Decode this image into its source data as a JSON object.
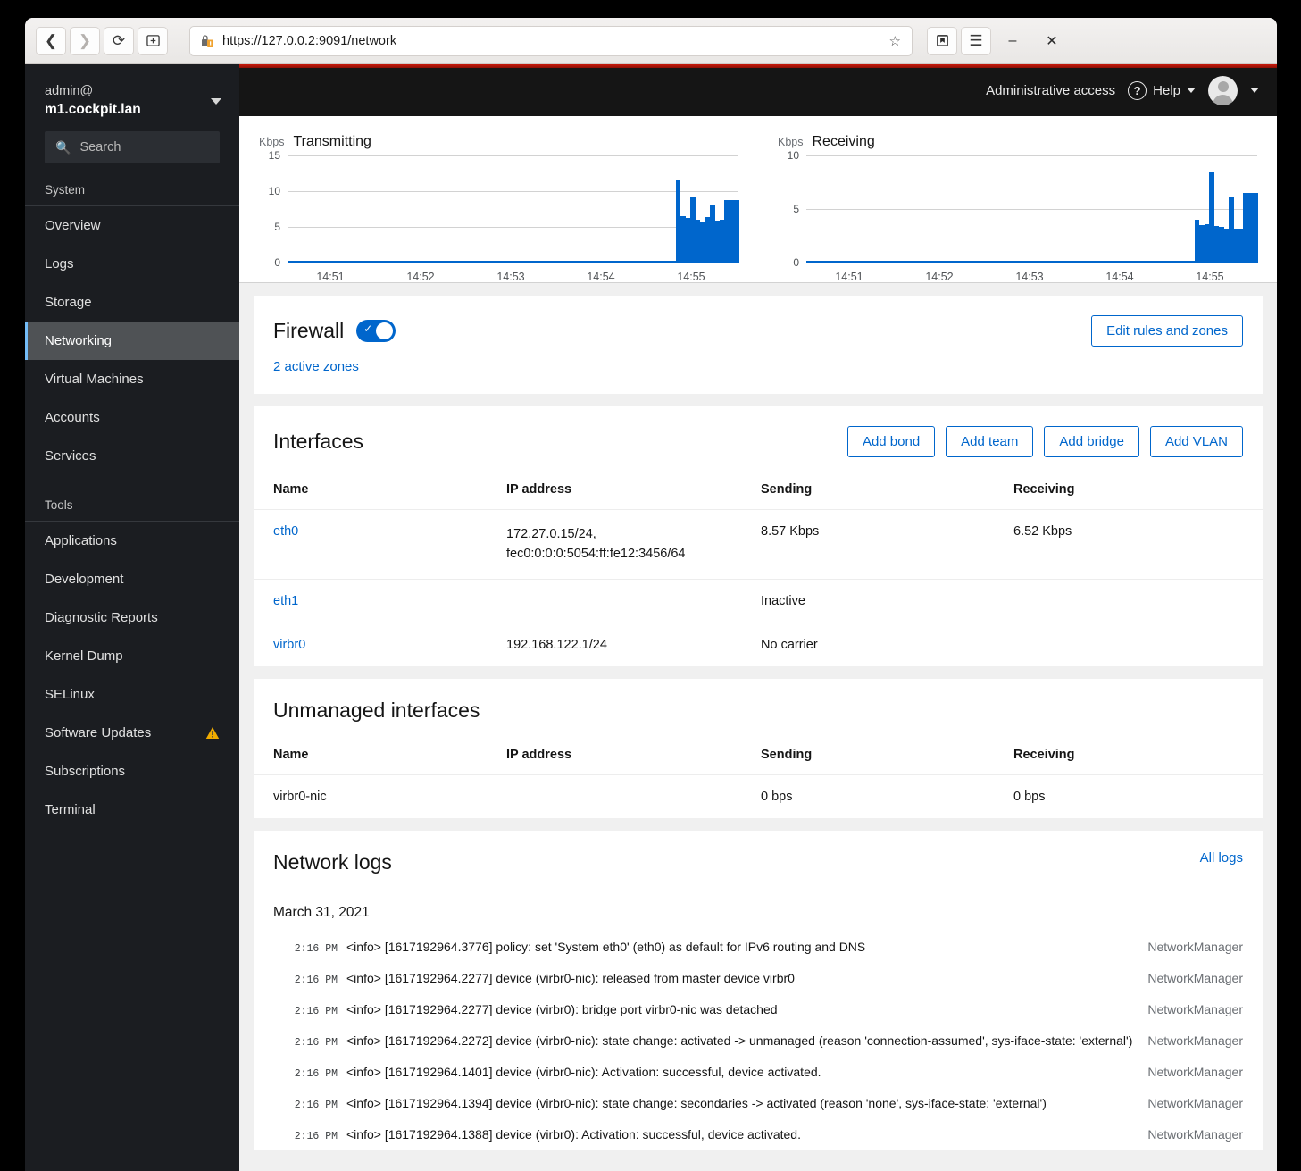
{
  "browser": {
    "back_icon": "back-arrow-icon",
    "forward_icon": "forward-arrow-icon",
    "reload_icon": "reload-icon",
    "newtab_icon": "new-tab-icon",
    "url": "https://127.0.0.2:9091/network",
    "bookmark_icon": "star-icon",
    "library_icon": "library-icon",
    "menu_icon": "hamburger-menu-icon",
    "minimize_label": "–",
    "close_label": "✕"
  },
  "sidebar": {
    "host_user": "admin@",
    "host_name": "m1.cockpit.lan",
    "search_placeholder": "Search",
    "groups": [
      {
        "title": "System",
        "items": [
          {
            "label": "Overview",
            "active": false
          },
          {
            "label": "Logs",
            "active": false
          },
          {
            "label": "Storage",
            "active": false
          },
          {
            "label": "Networking",
            "active": true
          },
          {
            "label": "Virtual Machines",
            "active": false
          },
          {
            "label": "Accounts",
            "active": false
          },
          {
            "label": "Services",
            "active": false
          }
        ]
      },
      {
        "title": "Tools",
        "items": [
          {
            "label": "Applications",
            "active": false
          },
          {
            "label": "Development",
            "active": false
          },
          {
            "label": "Diagnostic Reports",
            "active": false
          },
          {
            "label": "Kernel Dump",
            "active": false
          },
          {
            "label": "SELinux",
            "active": false
          },
          {
            "label": "Software Updates",
            "active": false,
            "badge": "warning-triangle-icon"
          },
          {
            "label": "Subscriptions",
            "active": false
          },
          {
            "label": "Terminal",
            "active": false
          }
        ]
      }
    ]
  },
  "header": {
    "admin_access": "Administrative access",
    "help_label": "Help",
    "help_icon": "question-circle-icon",
    "avatar_icon": "user-avatar-icon",
    "accent_color": "#c9190b"
  },
  "chart_data": [
    {
      "type": "area",
      "title": "Transmitting",
      "unit": "Kbps",
      "ylabel": "Kbps",
      "xlabel": "",
      "ylim": [
        0,
        15
      ],
      "yticks": [
        0,
        5,
        10,
        15
      ],
      "xticks": [
        "14:51",
        "14:52",
        "14:53",
        "14:54",
        "14:55"
      ],
      "grid": true,
      "series_color": "#06c",
      "values": [
        0,
        0,
        0,
        0,
        0,
        0,
        0,
        0,
        0,
        0,
        0,
        0,
        0,
        0,
        0,
        0,
        0,
        0,
        0,
        0,
        0,
        0,
        0,
        0,
        0,
        0,
        0,
        0,
        0,
        0,
        0,
        0,
        0,
        0,
        0,
        0,
        0,
        0,
        0,
        0,
        0,
        0,
        0,
        0,
        0,
        0,
        0,
        0,
        0,
        0,
        0,
        0,
        0,
        0,
        0,
        0,
        0,
        0,
        0,
        0,
        0,
        0,
        0,
        0,
        0,
        0,
        0,
        0,
        0,
        0,
        0,
        0,
        0,
        0,
        0,
        0,
        0,
        0,
        0,
        0,
        11.5,
        6.5,
        6.2,
        9.3,
        6.0,
        5.8,
        6.4,
        8.0,
        5.9,
        6.0,
        8.7,
        8.7,
        8.7
      ]
    },
    {
      "type": "area",
      "title": "Receiving",
      "unit": "Kbps",
      "ylabel": "Kbps",
      "xlabel": "",
      "ylim": [
        0,
        10
      ],
      "yticks": [
        0,
        5,
        10
      ],
      "xticks": [
        "14:51",
        "14:52",
        "14:53",
        "14:54",
        "14:55"
      ],
      "grid": true,
      "series_color": "#06c",
      "values": [
        0,
        0,
        0,
        0,
        0,
        0,
        0,
        0,
        0,
        0,
        0,
        0,
        0,
        0,
        0,
        0,
        0,
        0,
        0,
        0,
        0,
        0,
        0,
        0,
        0,
        0,
        0,
        0,
        0,
        0,
        0,
        0,
        0,
        0,
        0,
        0,
        0,
        0,
        0,
        0,
        0,
        0,
        0,
        0,
        0,
        0,
        0,
        0,
        0,
        0,
        0,
        0,
        0,
        0,
        0,
        0,
        0,
        0,
        0,
        0,
        0,
        0,
        0,
        0,
        0,
        0,
        0,
        0,
        0,
        0,
        0,
        0,
        0,
        0,
        0,
        0,
        0,
        0,
        0,
        0,
        4.0,
        3.5,
        3.6,
        8.4,
        3.4,
        3.3,
        3.2,
        6.1,
        3.2,
        3.2,
        6.5,
        6.5,
        6.5
      ]
    }
  ],
  "firewall": {
    "title": "Firewall",
    "enabled": true,
    "toggle_icon": "check-icon",
    "edit_button": "Edit rules and zones",
    "zones_link": "2 active zones"
  },
  "interfaces": {
    "title": "Interfaces",
    "buttons": [
      "Add bond",
      "Add team",
      "Add bridge",
      "Add VLAN"
    ],
    "columns": [
      "Name",
      "IP address",
      "Sending",
      "Receiving"
    ],
    "rows": [
      {
        "name": "eth0",
        "ip": [
          "172.27.0.15/24,",
          "fec0:0:0:0:5054:ff:fe12:3456/64"
        ],
        "sending": "8.57 Kbps",
        "receiving": "6.52 Kbps"
      },
      {
        "name": "eth1",
        "ip": [],
        "sending": "Inactive",
        "receiving": ""
      },
      {
        "name": "virbr0",
        "ip": [
          "192.168.122.1/24"
        ],
        "sending": "No carrier",
        "receiving": ""
      }
    ]
  },
  "unmanaged": {
    "title": "Unmanaged interfaces",
    "columns": [
      "Name",
      "IP address",
      "Sending",
      "Receiving"
    ],
    "rows": [
      {
        "name": "virbr0-nic",
        "ip": [],
        "sending": "0 bps",
        "receiving": "0 bps"
      }
    ]
  },
  "logs": {
    "title": "Network logs",
    "all_logs": "All logs",
    "date": "March 31, 2021",
    "entries": [
      {
        "time": "2:16 PM",
        "message": "<info> [1617192964.3776] policy: set 'System eth0' (eth0) as default for IPv6 routing and DNS",
        "source": "NetworkManager"
      },
      {
        "time": "2:16 PM",
        "message": "<info> [1617192964.2277] device (virbr0-nic): released from master device virbr0",
        "source": "NetworkManager"
      },
      {
        "time": "2:16 PM",
        "message": "<info> [1617192964.2277] device (virbr0): bridge port virbr0-nic was detached",
        "source": "NetworkManager"
      },
      {
        "time": "2:16 PM",
        "message": "<info> [1617192964.2272] device (virbr0-nic): state change: activated -> unmanaged (reason 'connection-assumed', sys-iface-state: 'external')",
        "source": "NetworkManager"
      },
      {
        "time": "2:16 PM",
        "message": "<info> [1617192964.1401] device (virbr0-nic): Activation: successful, device activated.",
        "source": "NetworkManager"
      },
      {
        "time": "2:16 PM",
        "message": "<info> [1617192964.1394] device (virbr0-nic): state change: secondaries -> activated (reason 'none', sys-iface-state: 'external')",
        "source": "NetworkManager"
      },
      {
        "time": "2:16 PM",
        "message": "<info> [1617192964.1388] device (virbr0): Activation: successful, device activated.",
        "source": "NetworkManager"
      }
    ]
  }
}
